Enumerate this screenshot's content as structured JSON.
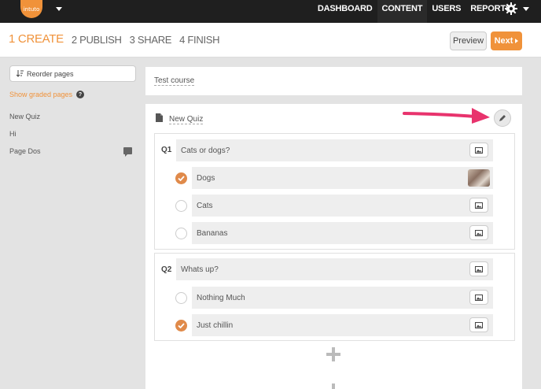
{
  "brand": {
    "logo_text": "intuto",
    "accent": "#f0923a"
  },
  "nav": {
    "items": [
      "DASHBOARD",
      "CONTENT",
      "USERS",
      "REPORTS"
    ],
    "active": "CONTENT"
  },
  "steps": [
    "1 CREATE",
    "2 PUBLISH",
    "3 SHARE",
    "4 FINISH"
  ],
  "actions": {
    "preview": "Preview",
    "next": "Next"
  },
  "sidebar": {
    "reorder_label": "Reorder pages",
    "graded_label": "Show graded pages",
    "pages": [
      "New Quiz",
      "Hi",
      "Page Dos"
    ]
  },
  "course": {
    "title": "Test course"
  },
  "quiz": {
    "title": "New Quiz",
    "questions": [
      {
        "num": "Q1",
        "text": "Cats or dogs?",
        "answers": [
          {
            "text": "Dogs",
            "checked": true
          },
          {
            "text": "Cats",
            "checked": false
          },
          {
            "text": "Bananas",
            "checked": false
          }
        ]
      },
      {
        "num": "Q2",
        "text": "Whats up?",
        "answers": [
          {
            "text": "Nothing Much",
            "checked": false
          },
          {
            "text": "Just chillin",
            "checked": true
          }
        ]
      }
    ]
  }
}
